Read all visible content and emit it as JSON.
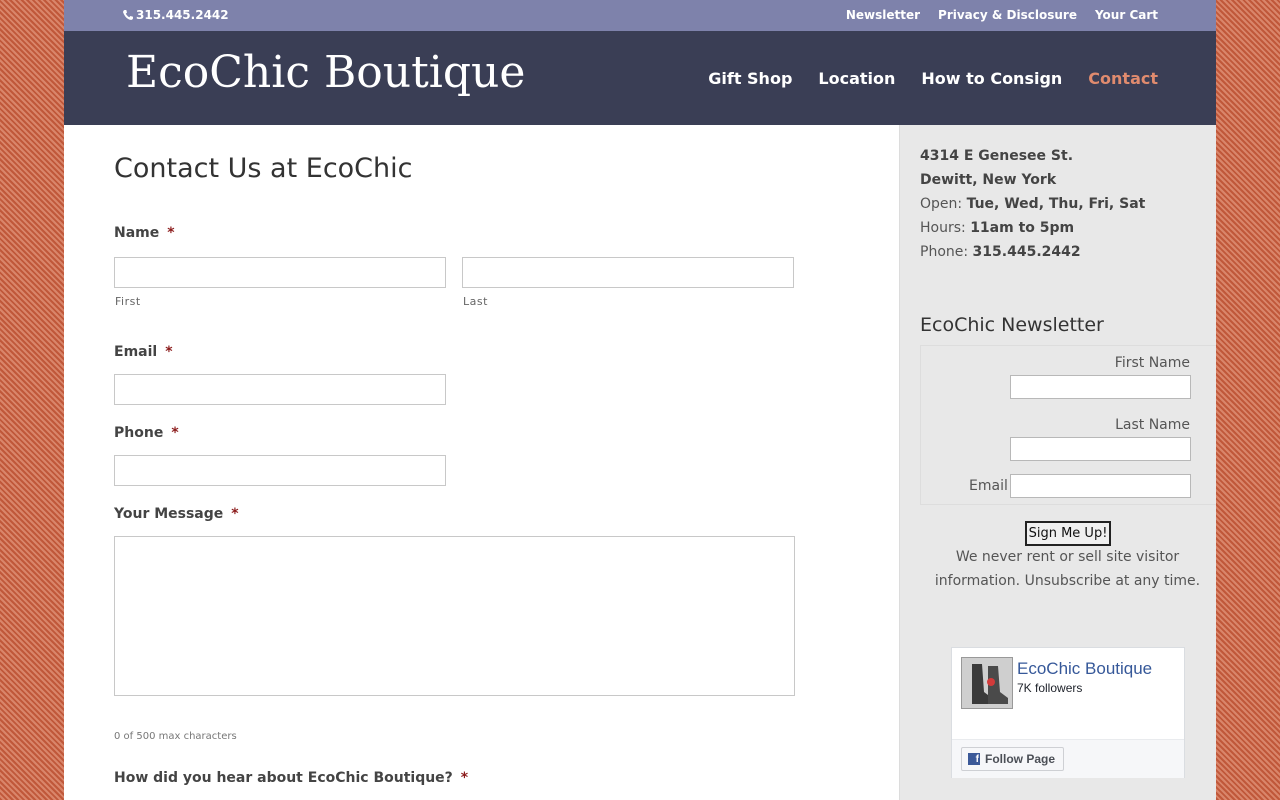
{
  "topbar": {
    "phone": "315.445.2442",
    "links": [
      "Newsletter",
      "Privacy & Disclosure",
      "Your Cart"
    ]
  },
  "header": {
    "logo": "EcoChic Boutique",
    "nav": [
      "Gift Shop",
      "Location",
      "How to Consign",
      "Contact"
    ],
    "active_nav": "Contact"
  },
  "form": {
    "title": "Contact Us at EcoChic",
    "required_mark": "*",
    "name_label": "Name",
    "first_sublabel": "First",
    "last_sublabel": "Last",
    "email_label": "Email",
    "phone_label": "Phone",
    "message_label": "Your Message",
    "counter": "0 of 500 max characters",
    "hear_label": "How did you hear about EcoChic Boutique?"
  },
  "sidebar": {
    "address_line1": "4314 E Genesee St.",
    "address_line2": "Dewitt, New York",
    "open_label": "Open:",
    "open_value": "Tue, Wed, Thu, Fri, Sat",
    "hours_label": "Hours:",
    "hours_value": "11am to 5pm",
    "phone_label": "Phone:",
    "phone_value": "315.445.2442",
    "newsletter_title": "EcoChic Newsletter",
    "first_name_label": "First Name",
    "last_name_label": "Last Name",
    "email_label": "Email",
    "signup_button": "Sign Me Up!",
    "privacy_text": "We never rent or sell site visitor information. Unsubscribe at any time.",
    "fb_name": "EcoChic Boutique",
    "fb_followers": "7K followers",
    "fb_follow_button": "Follow Page"
  },
  "colors": {
    "topbar": "#7e82ab",
    "header": "#3a3e55",
    "accent": "#e08b6e",
    "required": "#8b1a1a"
  }
}
